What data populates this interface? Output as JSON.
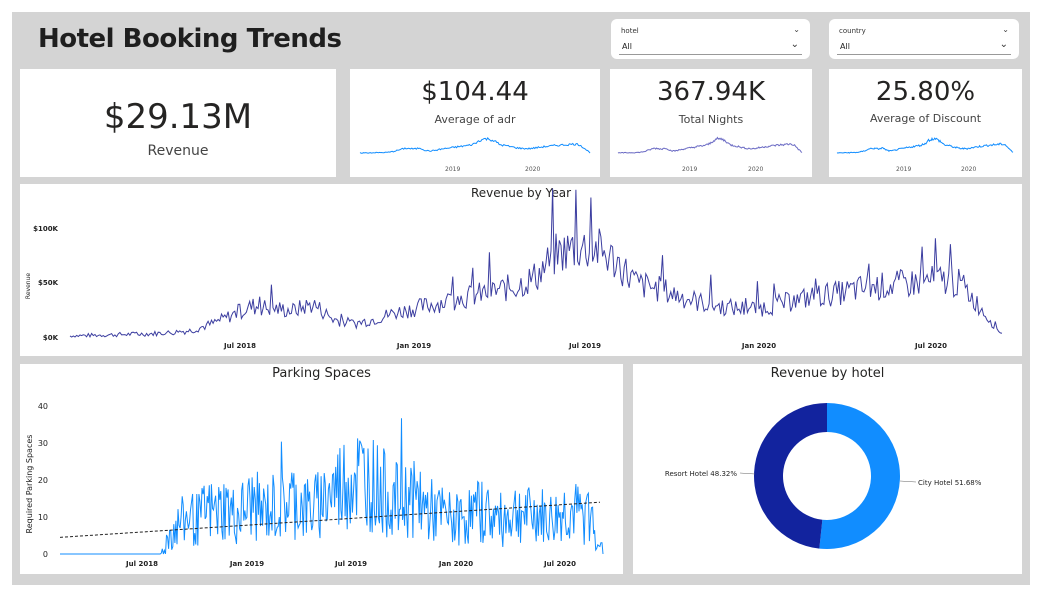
{
  "header": {
    "title": "Hotel Booking Trends"
  },
  "slicers": {
    "hotel": {
      "label": "hotel",
      "value": "All"
    },
    "country": {
      "label": "country",
      "value": "All"
    }
  },
  "kpis": {
    "revenue": {
      "value": "$29.13M",
      "label": "Revenue"
    },
    "adr": {
      "value": "$104.44",
      "label": "Average of adr",
      "ticks": [
        "2019",
        "2020"
      ]
    },
    "nights": {
      "value": "367.94K",
      "label": "Total Nights",
      "ticks": [
        "2019",
        "2020"
      ]
    },
    "discount": {
      "value": "25.80%",
      "label": "Average of Discount",
      "ticks": [
        "2019",
        "2020"
      ]
    }
  },
  "colors": {
    "line_dark": "#3c3ea0",
    "line_blue": "#118dff",
    "line_purple": "#6b6bc4",
    "donut_dark": "#12239e",
    "donut_light": "#118dff"
  },
  "chart_data": [
    {
      "type": "line",
      "title": "Revenue by Year",
      "ylabel": "Revenue",
      "xlabel": "",
      "x_ticks": [
        "Jul 2018",
        "Jan 2019",
        "Jul 2019",
        "Jan 2020",
        "Jul 2020"
      ],
      "y_ticks": [
        "$0K",
        "$50K",
        "$100K"
      ],
      "ylim": [
        0,
        120000
      ],
      "x_range": [
        "2018-01",
        "2020-09"
      ],
      "series": [
        {
          "values": [
            1000,
            1500,
            2000,
            2500,
            3000,
            4000,
            6000,
            12000,
            20000,
            28000,
            26000,
            24000,
            30000,
            16000,
            12000,
            16000,
            22000,
            26000,
            30000,
            34000,
            38000,
            42000,
            46000,
            55000,
            75000,
            82000,
            80000,
            68000,
            48000,
            44000,
            38000,
            32000,
            28000,
            26000,
            26000,
            30000,
            34000,
            38000,
            40000,
            44000,
            46000,
            48000,
            50000,
            52000,
            48000,
            25000,
            3000
          ]
        }
      ]
    },
    {
      "type": "line",
      "title": "Parking Spaces",
      "ylabel": "Required Parking Spaces",
      "xlabel": "",
      "x_ticks": [
        "Jul 2018",
        "Jan 2019",
        "Jul 2019",
        "Jan 2020",
        "Jul 2020"
      ],
      "y_ticks": [
        "0",
        "10",
        "20",
        "30",
        "40"
      ],
      "ylim": [
        0,
        45
      ],
      "series": [
        {
          "values": [
            0,
            0,
            0,
            0,
            0,
            0,
            0,
            0,
            0,
            0,
            0,
            0,
            6,
            8,
            10,
            9,
            12,
            11,
            13,
            10,
            12,
            14,
            11,
            13,
            12,
            15,
            14,
            12,
            13,
            16,
            18,
            20,
            22,
            21,
            19,
            17,
            15,
            14,
            16,
            13,
            12,
            11,
            10,
            9,
            10,
            11,
            12,
            10,
            9,
            11,
            12,
            10,
            11,
            9,
            10,
            12,
            11,
            10,
            9,
            0
          ]
        }
      ],
      "trendline": [
        4.5,
        14
      ]
    },
    {
      "type": "pie",
      "title": "Revenue by hotel",
      "slices": [
        {
          "name": "City Hotel",
          "value": 51.68,
          "label": "City Hotel 51.68%"
        },
        {
          "name": "Resort Hotel",
          "value": 48.32,
          "label": "Resort Hotel 48.32%"
        }
      ]
    }
  ]
}
